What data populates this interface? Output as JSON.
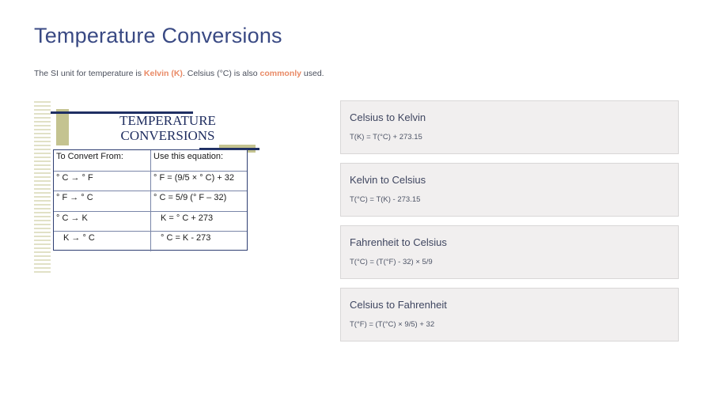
{
  "title": "Temperature Conversions",
  "subtitle": {
    "part1": "The SI unit for temperature is ",
    "kelvin": "Kelvin (K)",
    "part2": ". Celsius (°C) is also ",
    "commonly": "commonly",
    "part3": " used."
  },
  "image": {
    "title_line1": "TEMPERATURE",
    "title_line2": "CONVERSIONS",
    "table": {
      "headers": [
        "To Convert From:",
        "Use this equation:"
      ],
      "rows": [
        [
          "° C → ° F",
          "° F = (9/5 × ° C) + 32"
        ],
        [
          "° F → ° C",
          "° C = 5/9 (° F – 32)"
        ],
        [
          "° C → K",
          "K = ° C + 273"
        ],
        [
          "K → ° C",
          "° C = K - 273"
        ]
      ]
    }
  },
  "cards": [
    {
      "title": "Celsius to Kelvin",
      "equation": "T(K) = T(°C) + 273.15"
    },
    {
      "title": "Kelvin to Celsius",
      "equation": "T(°C) = T(K) - 273.15"
    },
    {
      "title": "Fahrenheit to Celsius",
      "equation": "T(°C) = (T(°F) - 32) × 5/9"
    },
    {
      "title": "Celsius to Fahrenheit",
      "equation": "T(°F) = (T(°C) × 9/5) + 32"
    }
  ],
  "colors": {
    "title": "#3a4a84",
    "highlight": "#e98a66",
    "card_bg": "#f1efef"
  }
}
